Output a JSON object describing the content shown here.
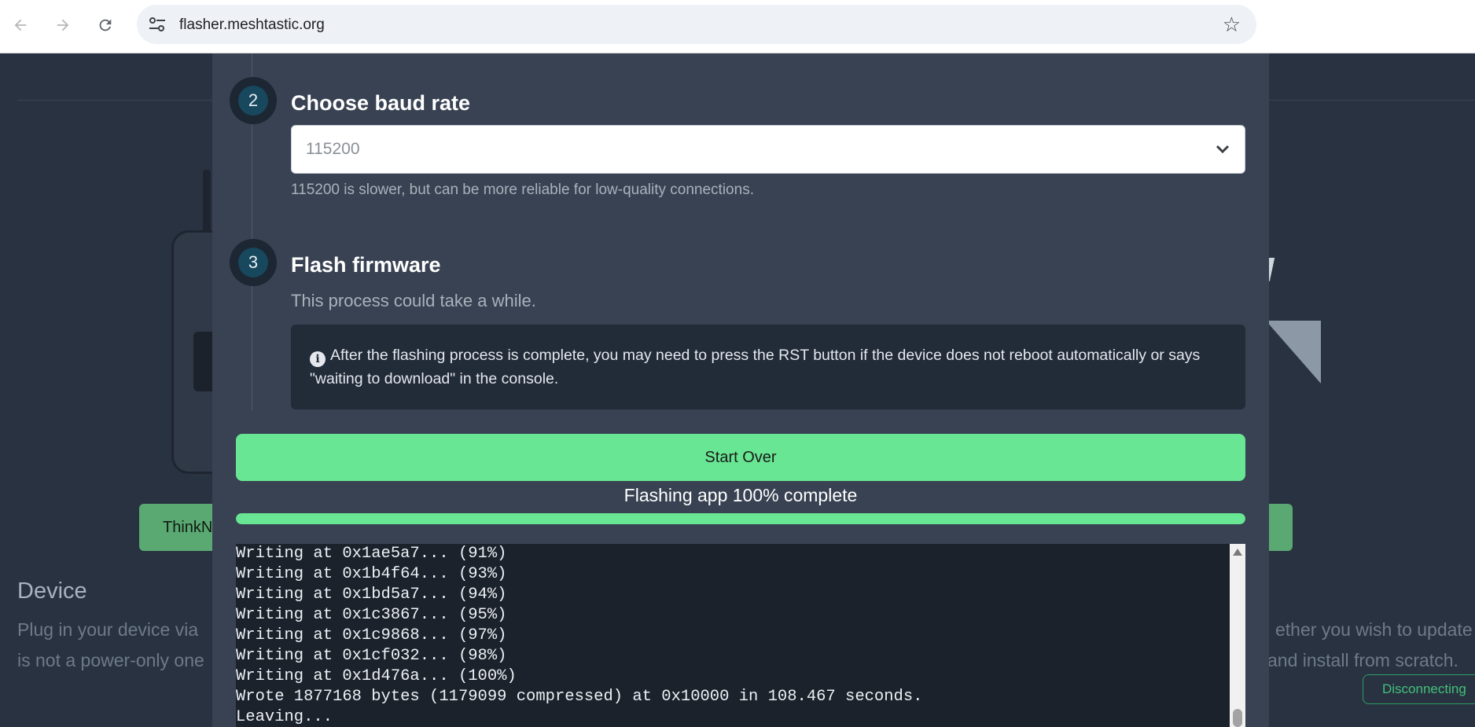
{
  "browser": {
    "url": "flasher.meshtastic.org"
  },
  "background": {
    "device_button_label": "ThinkN",
    "section_heading": "Device",
    "left_text_line1": "Plug in your device via",
    "left_text_line2": "is not a power-only one",
    "right_text_line1": "ether you wish to update",
    "right_text_line2": "and install from scratch.",
    "status_button_label": "Disconnecting"
  },
  "steps": [
    {
      "number": "2",
      "title": "Choose baud rate",
      "select_value": "115200",
      "help_text": "115200 is slower, but can be more reliable for low-quality connections."
    },
    {
      "number": "3",
      "title": "Flash firmware",
      "subtitle": "This process could take a while.",
      "info_text": "After the flashing process is complete, you may need to press the RST button if the device does not reboot automatically or says \"waiting to download\" in the console."
    }
  ],
  "actions": {
    "start_over_label": "Start Over"
  },
  "progress": {
    "label": "Flashing app 100% complete",
    "percent": 100
  },
  "console": {
    "lines": [
      "Writing at 0x1ae5a7... (91%)",
      "Writing at 0x1b4f64... (93%)",
      "Writing at 0x1bd5a7... (94%)",
      "Writing at 0x1c3867... (95%)",
      "Writing at 0x1c9868... (97%)",
      "Writing at 0x1cf032... (98%)",
      "Writing at 0x1d476a... (100%)",
      "Wrote 1877168 bytes (1179099 compressed) at 0x10000 in 108.467 seconds.",
      "Leaving..."
    ]
  },
  "colors": {
    "accent_green": "#68e693",
    "modal_bg": "#384252",
    "page_bg": "#283241",
    "console_bg": "#1b222c"
  }
}
